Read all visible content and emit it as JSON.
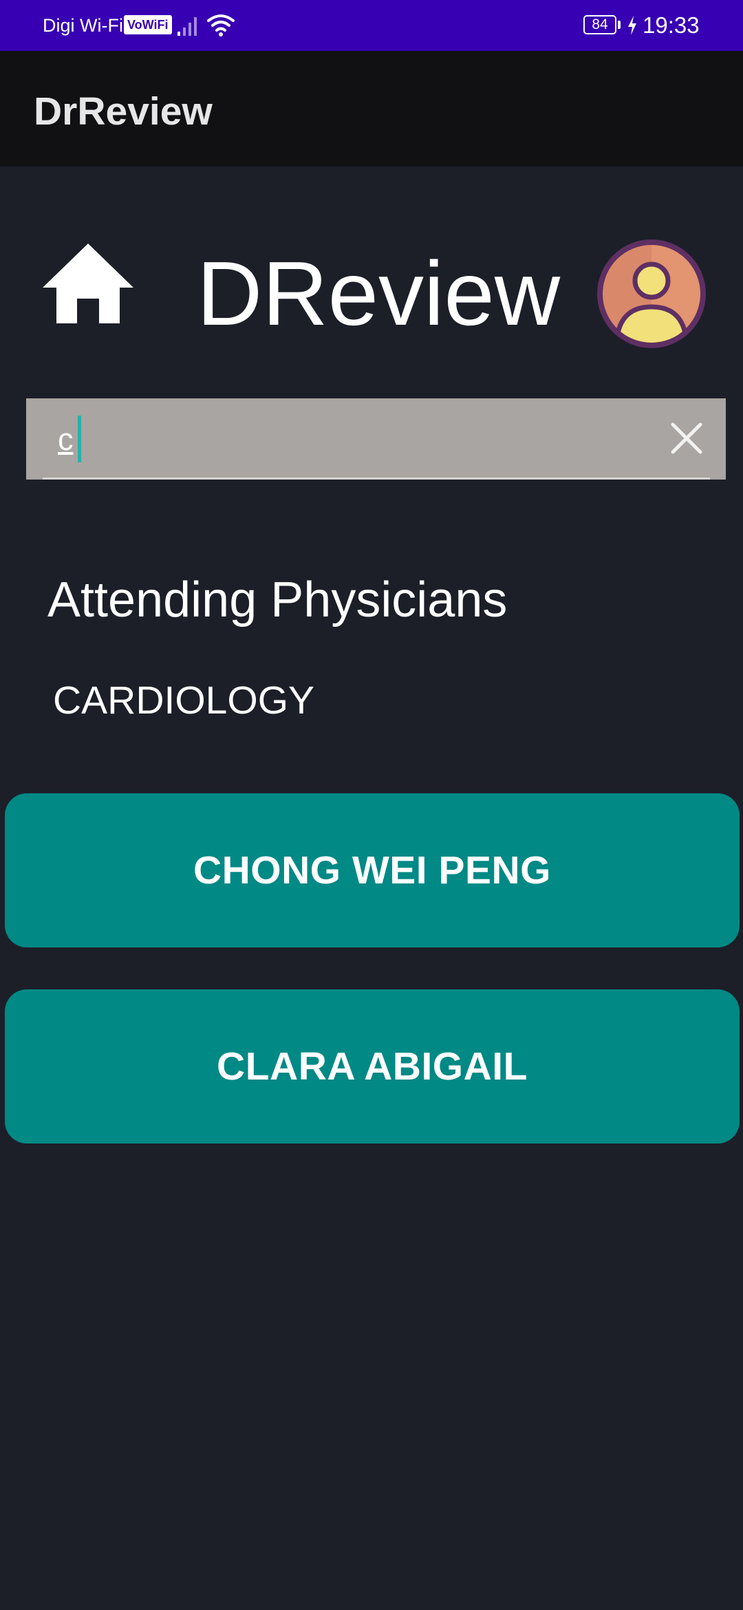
{
  "status_bar": {
    "carrier": "Digi Wi-Fi",
    "vowifi_badge": "VoWiFi",
    "battery_level": "84",
    "time": "19:33"
  },
  "app_bar": {
    "title": "DrReview"
  },
  "header": {
    "brand_title": "DReview",
    "home_icon": "home-icon",
    "avatar_icon": "avatar-icon"
  },
  "search": {
    "value": "c",
    "clear_icon": "close-icon"
  },
  "section": {
    "title": "Attending Physicians",
    "department": "CARDIOLOGY"
  },
  "physicians": [
    {
      "name": "CHONG WEI PENG"
    },
    {
      "name": "CLARA ABIGAIL"
    }
  ],
  "colors": {
    "status_bar": "#3800b3",
    "app_bar": "#111113",
    "background": "#1c1f28",
    "search_box": "#a9a5a3",
    "button": "#008985",
    "caret": "#26b3a8"
  }
}
